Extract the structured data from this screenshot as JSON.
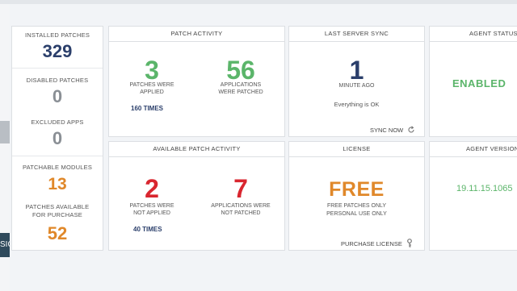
{
  "left_tab_text": "SIO",
  "summary": {
    "installed_label": "INSTALLED PATCHES",
    "installed_value": "329",
    "disabled_label": "DISABLED PATCHES",
    "disabled_value": "0",
    "excluded_label": "EXCLUDED APPS",
    "excluded_value": "0",
    "modules_label": "PATCHABLE MODULES",
    "modules_value": "13",
    "purchase_label_1": "PATCHES AVAILABLE",
    "purchase_label_2": "FOR PURCHASE",
    "purchase_value": "52"
  },
  "patch_activity": {
    "title": "PATCH ACTIVITY",
    "applied_value": "3",
    "applied_line1": "PATCHES WERE",
    "applied_line2": "APPLIED",
    "times": "160 TIMES",
    "apps_value": "56",
    "apps_line1": "APPLICATIONS",
    "apps_line2": "WERE PATCHED"
  },
  "server_sync": {
    "title": "LAST SERVER SYNC",
    "value": "1",
    "unit": "MINUTE AGO",
    "status": "Everything is OK",
    "sync_label": "SYNC NOW"
  },
  "agent_status": {
    "title": "AGENT STATUS",
    "value": "ENABLED"
  },
  "available_activity": {
    "title": "AVAILABLE PATCH ACTIVITY",
    "not_applied_value": "2",
    "not_applied_line1": "PATCHES WERE",
    "not_applied_line2": "NOT APPLIED",
    "times": "40 TIMES",
    "not_patched_value": "7",
    "not_patched_line1": "APPLICATIONS WERE",
    "not_patched_line2": "NOT PATCHED"
  },
  "license": {
    "title": "LICENSE",
    "value": "FREE",
    "line1": "FREE PATCHES ONLY",
    "line2": "PERSONAL USE ONLY",
    "purchase_label": "PURCHASE LICENSE"
  },
  "agent_version": {
    "title": "AGENT VERSION",
    "value": "19.11.15.1065"
  },
  "colors": {
    "navy": "#2b3f6b",
    "green": "#5bb56a",
    "red": "#d9262f",
    "orange": "#e0882a"
  }
}
